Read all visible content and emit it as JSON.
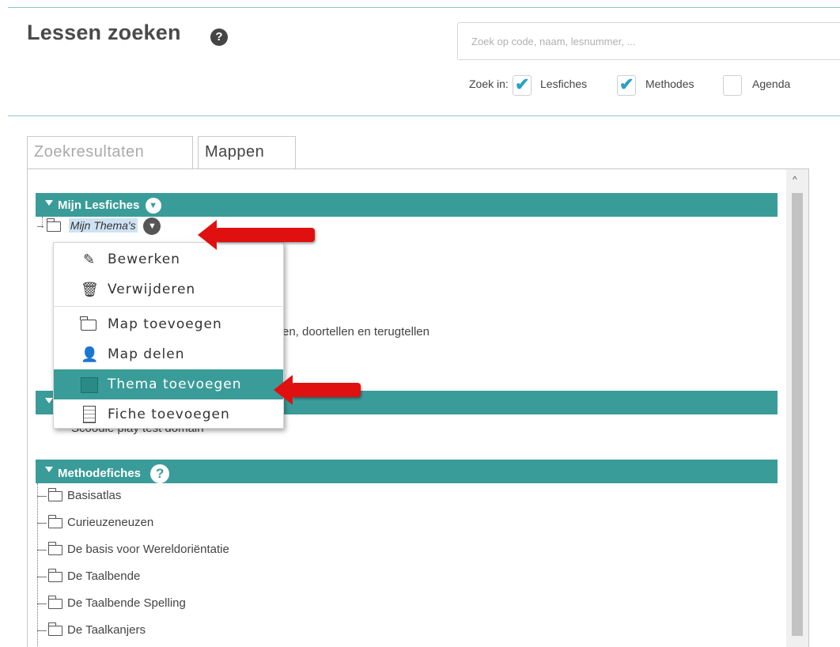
{
  "header": {
    "title": "Lessen zoeken",
    "help_icon": "question-icon",
    "search_placeholder": "Zoek op code, naam, lesnummer, ...",
    "zoek_in_label": "Zoek in:",
    "filters": [
      {
        "label": "Lesfiches",
        "checked": true
      },
      {
        "label": "Methodes",
        "checked": true
      },
      {
        "label": "Agenda",
        "checked": false
      }
    ]
  },
  "tabs": [
    {
      "label": "Zoekresultaten",
      "active": false
    },
    {
      "label": "Mappen",
      "active": true
    }
  ],
  "sections": {
    "mijn_lesfiches": "Mijn Lesfiches",
    "mijn_themas": "Mijn Thema's",
    "behind_menu_text": "en, doortellen en terugtellen",
    "behind_menu_text2": "Scoodle play test domain",
    "methodefiches": "Methodefiches"
  },
  "methodefiches_items": [
    "Basisatlas",
    "Curieuzeneuzen",
    "De basis voor Wereldoriëntatie",
    "De Taalbende",
    "De Taalbende Spelling",
    "De Taalkanjers"
  ],
  "context_menu": [
    {
      "label": "Bewerken",
      "icon": "edit-icon"
    },
    {
      "label": "Verwijderen",
      "icon": "trash-icon"
    },
    {
      "label": "Map toevoegen",
      "icon": "folder-icon"
    },
    {
      "label": "Map delen",
      "icon": "user-icon"
    },
    {
      "label": "Thema toevoegen",
      "icon": "theme-icon",
      "active": true
    },
    {
      "label": "Fiche toevoegen",
      "icon": "fiche-icon"
    }
  ],
  "colors": {
    "accent": "#3a9c99",
    "arrow": "#e01010",
    "check": "#2aa0c4"
  }
}
